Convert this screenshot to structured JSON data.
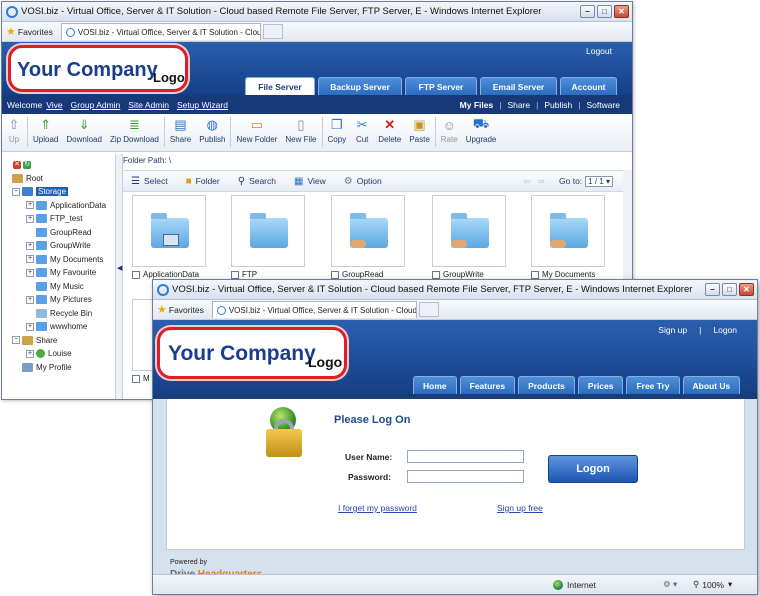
{
  "window1": {
    "title": "VOSI.biz - Virtual Office, Server & IT Solution - Cloud based Remote File Server, FTP Server, E - Windows Internet Explorer",
    "favorites_label": "Favorites",
    "tab_title": "VOSI.biz - Virtual Office, Server & IT Solution - Cloud ...",
    "logo_main": "Your Company",
    "logo_sub": "Logo",
    "logout": "Logout",
    "nav_tabs": [
      "File Server",
      "Backup Server",
      "FTP Server",
      "Email Server",
      "Account"
    ],
    "subnav": {
      "welcome": "Welcome",
      "links": [
        "Vive",
        "Group Admin",
        "Site Admin",
        "Setup Wizard"
      ],
      "right": [
        "My Files",
        "Share",
        "Publish",
        "Software"
      ]
    },
    "toolbar": [
      "Up",
      "Upload",
      "Download",
      "Zip Download",
      "Share",
      "Publish",
      "New Folder",
      "New File",
      "Copy",
      "Cut",
      "Delete",
      "Paste",
      "Rate",
      "Upgrade"
    ],
    "tree": {
      "root": "Root",
      "storage": "Storage",
      "storage_children": [
        "ApplicationData",
        "FTP_test",
        "GroupRead",
        "GroupWrite",
        "My Documents",
        "My Favourite",
        "My Music",
        "My Pictures",
        "Recycle Bin",
        "wwwhome"
      ],
      "share": "Share",
      "share_children": [
        "Louise"
      ],
      "profile": "My Profile"
    },
    "folder_path_label": "Folder Path:",
    "folder_path_value": "\\",
    "pane_toolbar": [
      "Select",
      "Folder",
      "Search",
      "View",
      "Option"
    ],
    "goto_label": "Go to:",
    "goto_value": "1 / 1",
    "files": [
      "ApplicationData",
      "FTP",
      "GroupRead",
      "GroupWrite",
      "My Documents"
    ],
    "partial_file_letter": "M"
  },
  "window2": {
    "title": "VOSI.biz - Virtual Office, Server & IT Solution - Cloud based Remote File Server, FTP Server, E - Windows Internet Explorer",
    "favorites_label": "Favorites",
    "tab_title": "VOSI.biz - Virtual Office, Server & IT Solution - Cloud ...",
    "logo_main": "Your Company",
    "logo_sub": "Logo",
    "top_links": [
      "Sign up",
      "|",
      "Logon"
    ],
    "nav_tabs": [
      "Home",
      "Features",
      "Products",
      "Prices",
      "Free Try",
      "About Us"
    ],
    "login": {
      "heading": "Please Log On",
      "username_label": "User Name:",
      "password_label": "Password:",
      "button": "Logon",
      "forgot": "I forget my password",
      "signup": "Sign up free"
    },
    "powered_by": "Powered by",
    "brand_drive": "Drive",
    "brand_hq": "Headquarters",
    "status_zone": "Internet",
    "status_zoom": "100%"
  },
  "colors": {
    "header_blue": "#1f4e9a",
    "logo_red": "#d8202a",
    "accent_orange": "#e07a12"
  }
}
